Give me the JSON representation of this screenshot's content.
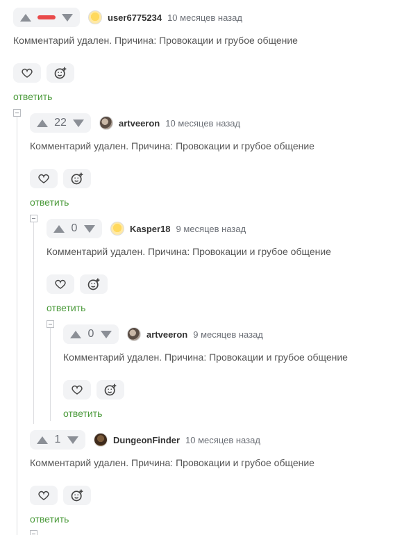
{
  "comments": [
    {
      "score": "",
      "score_negative": true,
      "user": "user6775234",
      "avatar": "sleep-avatar",
      "time": "10 месяцев назад",
      "text": "Комментарий удален. Причина: Провокации и грубое общение",
      "reply": "ответить"
    },
    {
      "score": "22",
      "score_negative": false,
      "user": "artveeron",
      "avatar": "artveeron-avatar",
      "time": "10 месяцев назад",
      "text": "Комментарий удален. Причина: Провокации и грубое общение",
      "reply": "ответить"
    },
    {
      "score": "0",
      "score_negative": false,
      "user": "Kasper18",
      "avatar": "sleep-avatar",
      "time": "9 месяцев назад",
      "text": "Комментарий удален. Причина: Провокации и грубое общение",
      "reply": "ответить"
    },
    {
      "score": "0",
      "score_negative": false,
      "user": "artveeron",
      "avatar": "artveeron-avatar",
      "time": "9 месяцев назад",
      "text": "Комментарий удален. Причина: Провокации и грубое общение",
      "reply": "ответить"
    },
    {
      "score": "1",
      "score_negative": false,
      "user": "DungeonFinder",
      "avatar": "dungeonfinder-avatar",
      "time": "10 месяцев назад",
      "text": "Комментарий удален. Причина: Провокации и грубое общение",
      "reply": "ответить"
    }
  ],
  "colors": {
    "accent_reply": "#4a9a3a",
    "negative_score": "#e94a4a"
  }
}
